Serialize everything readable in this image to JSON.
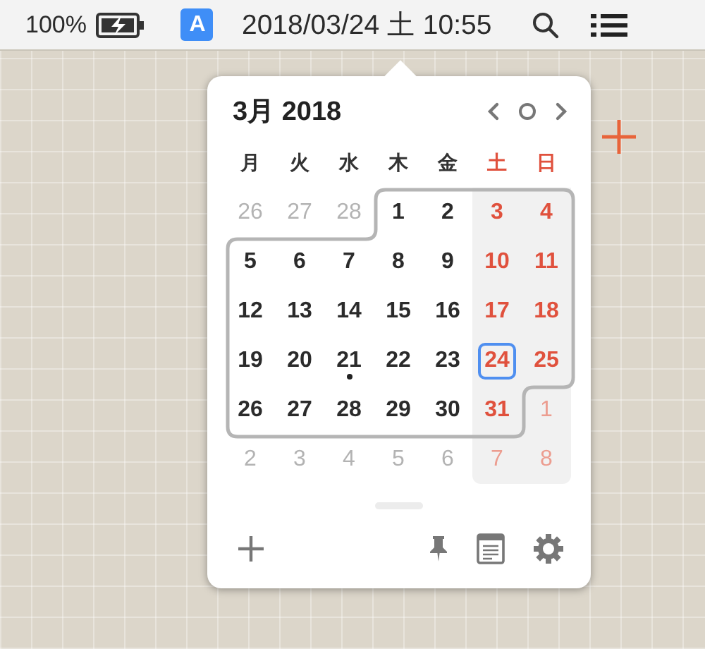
{
  "menu_bar": {
    "battery_percent": "100%",
    "input_source": "A",
    "clock": "2018/03/24 土 10:55"
  },
  "calendar": {
    "title": "3月 2018",
    "weekdays": [
      {
        "label": "月",
        "weekend": false
      },
      {
        "label": "火",
        "weekend": false
      },
      {
        "label": "水",
        "weekend": false
      },
      {
        "label": "木",
        "weekend": false
      },
      {
        "label": "金",
        "weekend": false
      },
      {
        "label": "土",
        "weekend": true
      },
      {
        "label": "日",
        "weekend": true
      }
    ],
    "weeks": [
      [
        {
          "label": "26",
          "in_month": false,
          "today": false,
          "event": false
        },
        {
          "label": "27",
          "in_month": false,
          "today": false,
          "event": false
        },
        {
          "label": "28",
          "in_month": false,
          "today": false,
          "event": false
        },
        {
          "label": "1",
          "in_month": true,
          "today": false,
          "event": false
        },
        {
          "label": "2",
          "in_month": true,
          "today": false,
          "event": false
        },
        {
          "label": "3",
          "in_month": true,
          "today": false,
          "event": false
        },
        {
          "label": "4",
          "in_month": true,
          "today": false,
          "event": false
        }
      ],
      [
        {
          "label": "5",
          "in_month": true,
          "today": false,
          "event": false
        },
        {
          "label": "6",
          "in_month": true,
          "today": false,
          "event": false
        },
        {
          "label": "7",
          "in_month": true,
          "today": false,
          "event": false
        },
        {
          "label": "8",
          "in_month": true,
          "today": false,
          "event": false
        },
        {
          "label": "9",
          "in_month": true,
          "today": false,
          "event": false
        },
        {
          "label": "10",
          "in_month": true,
          "today": false,
          "event": false
        },
        {
          "label": "11",
          "in_month": true,
          "today": false,
          "event": false
        }
      ],
      [
        {
          "label": "12",
          "in_month": true,
          "today": false,
          "event": false
        },
        {
          "label": "13",
          "in_month": true,
          "today": false,
          "event": false
        },
        {
          "label": "14",
          "in_month": true,
          "today": false,
          "event": false
        },
        {
          "label": "15",
          "in_month": true,
          "today": false,
          "event": false
        },
        {
          "label": "16",
          "in_month": true,
          "today": false,
          "event": false
        },
        {
          "label": "17",
          "in_month": true,
          "today": false,
          "event": false
        },
        {
          "label": "18",
          "in_month": true,
          "today": false,
          "event": false
        }
      ],
      [
        {
          "label": "19",
          "in_month": true,
          "today": false,
          "event": false
        },
        {
          "label": "20",
          "in_month": true,
          "today": false,
          "event": false
        },
        {
          "label": "21",
          "in_month": true,
          "today": false,
          "event": true
        },
        {
          "label": "22",
          "in_month": true,
          "today": false,
          "event": false
        },
        {
          "label": "23",
          "in_month": true,
          "today": false,
          "event": false
        },
        {
          "label": "24",
          "in_month": true,
          "today": true,
          "event": false
        },
        {
          "label": "25",
          "in_month": true,
          "today": false,
          "event": false
        }
      ],
      [
        {
          "label": "26",
          "in_month": true,
          "today": false,
          "event": false
        },
        {
          "label": "27",
          "in_month": true,
          "today": false,
          "event": false
        },
        {
          "label": "28",
          "in_month": true,
          "today": false,
          "event": false
        },
        {
          "label": "29",
          "in_month": true,
          "today": false,
          "event": false
        },
        {
          "label": "30",
          "in_month": true,
          "today": false,
          "event": false
        },
        {
          "label": "31",
          "in_month": true,
          "today": false,
          "event": false
        },
        {
          "label": "1",
          "in_month": false,
          "today": false,
          "event": false
        }
      ],
      [
        {
          "label": "2",
          "in_month": false,
          "today": false,
          "event": false
        },
        {
          "label": "3",
          "in_month": false,
          "today": false,
          "event": false
        },
        {
          "label": "4",
          "in_month": false,
          "today": false,
          "event": false
        },
        {
          "label": "5",
          "in_month": false,
          "today": false,
          "event": false
        },
        {
          "label": "6",
          "in_month": false,
          "today": false,
          "event": false
        },
        {
          "label": "7",
          "in_month": false,
          "today": false,
          "event": false
        },
        {
          "label": "8",
          "in_month": false,
          "today": false,
          "event": false
        }
      ]
    ]
  }
}
